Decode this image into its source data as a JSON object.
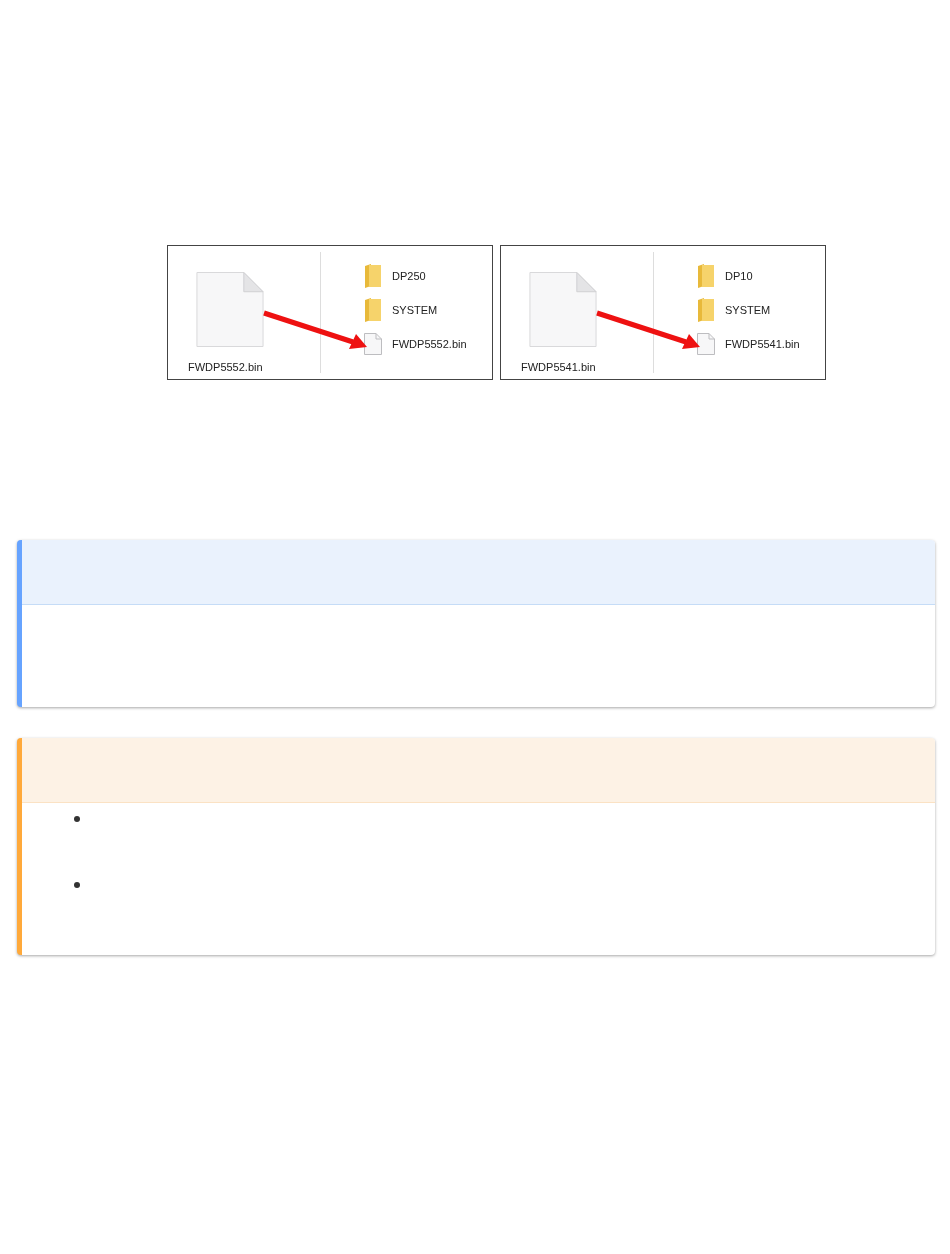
{
  "screenshots": [
    {
      "source_file": "FWDP5552.bin",
      "items": [
        {
          "kind": "folder",
          "name": "DP250"
        },
        {
          "kind": "folder",
          "name": "SYSTEM"
        },
        {
          "kind": "file",
          "name": "FWDP5552.bin"
        }
      ]
    },
    {
      "source_file": "FWDP5541.bin",
      "items": [
        {
          "kind": "folder",
          "name": "DP10"
        },
        {
          "kind": "folder",
          "name": "SYSTEM"
        },
        {
          "kind": "file",
          "name": "FWDP5541.bin"
        }
      ]
    }
  ],
  "callouts": [
    {
      "kind": "info"
    },
    {
      "kind": "warning",
      "items": [
        {
          "kind": "bullet"
        },
        {
          "kind": "bullet"
        }
      ]
    }
  ]
}
